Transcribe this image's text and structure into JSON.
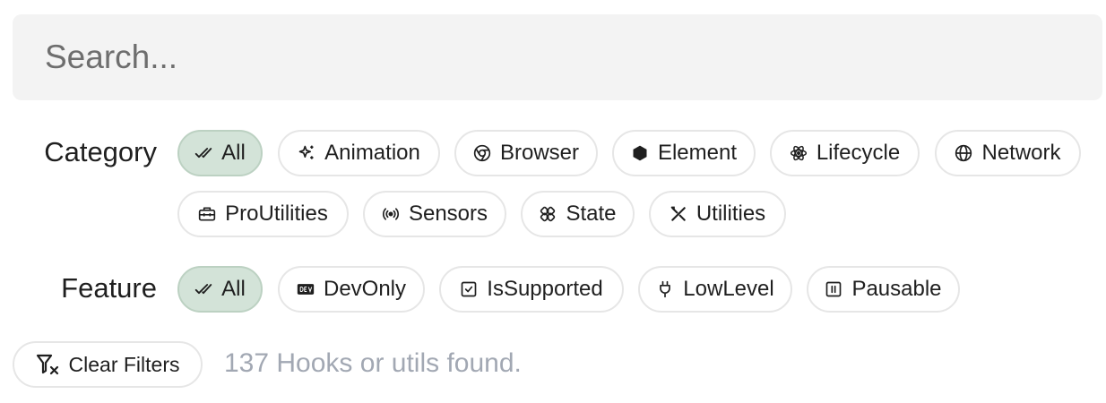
{
  "search": {
    "placeholder": "Search..."
  },
  "category": {
    "label": "Category",
    "chips": [
      {
        "label": "All",
        "icon": "check-check-icon",
        "active": true
      },
      {
        "label": "Animation",
        "icon": "sparkles-icon",
        "active": false
      },
      {
        "label": "Browser",
        "icon": "chrome-icon",
        "active": false
      },
      {
        "label": "Element",
        "icon": "hexagon-icon",
        "active": false
      },
      {
        "label": "Lifecycle",
        "icon": "atom-icon",
        "active": false
      },
      {
        "label": "Network",
        "icon": "globe-icon",
        "active": false
      },
      {
        "label": "ProUtilities",
        "icon": "toolbox-icon",
        "active": false
      },
      {
        "label": "Sensors",
        "icon": "radio-icon",
        "active": false
      },
      {
        "label": "State",
        "icon": "state-icon",
        "active": false
      },
      {
        "label": "Utilities",
        "icon": "tools-icon",
        "active": false
      }
    ]
  },
  "feature": {
    "label": "Feature",
    "chips": [
      {
        "label": "All",
        "icon": "check-check-icon",
        "active": true
      },
      {
        "label": "DevOnly",
        "icon": "dev-badge-icon",
        "active": false
      },
      {
        "label": "IsSupported",
        "icon": "checkbox-icon",
        "active": false
      },
      {
        "label": "LowLevel",
        "icon": "plug-icon",
        "active": false
      },
      {
        "label": "Pausable",
        "icon": "pause-box-icon",
        "active": false
      }
    ]
  },
  "clear_filters": {
    "label": "Clear Filters",
    "icon": "filter-x-icon"
  },
  "results": {
    "text": "137 Hooks or utils found."
  },
  "colors": {
    "search_bg": "#f3f3f3",
    "active_chip_bg": "#d3e3d8",
    "chip_border": "#e6e6e6",
    "muted_text": "#a2a8b3"
  }
}
